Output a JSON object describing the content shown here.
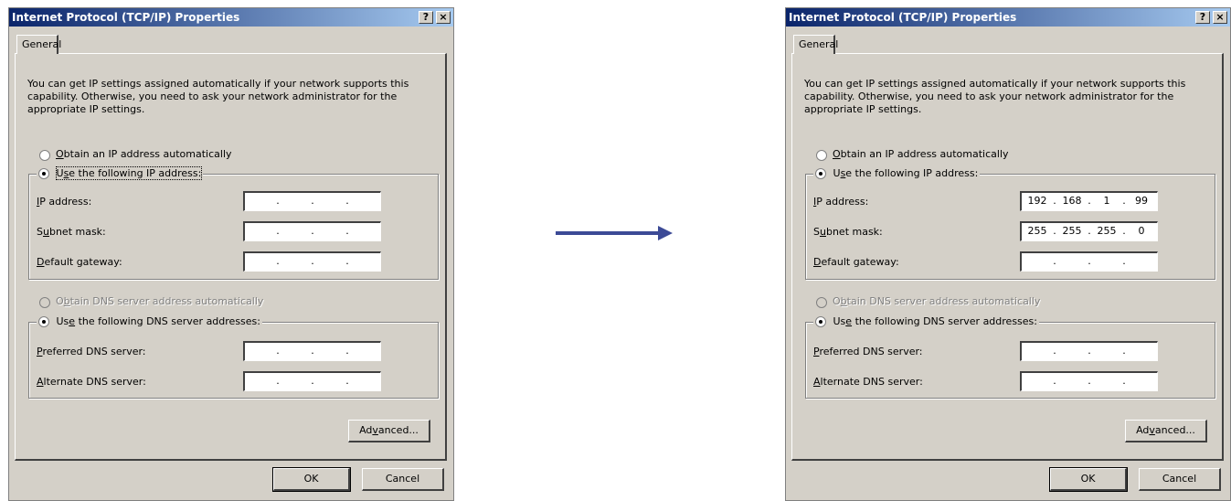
{
  "dialog_title": "Internet Protocol (TCP/IP) Properties",
  "help_button": "?",
  "close_button": "×",
  "tab_general": "General",
  "intro_text": "You can get IP settings assigned automatically if your network supports this capability. Otherwise, you need to ask your network administrator for the appropriate IP settings.",
  "ip_section": {
    "auto_option": {
      "pre": "",
      "key": "O",
      "post": "btain an IP address automatically"
    },
    "manual_option": {
      "pre": "U",
      "key": "s",
      "post": "e the following IP address:"
    },
    "fields": [
      {
        "pre": "",
        "key": "I",
        "post": "P address:"
      },
      {
        "pre": "S",
        "key": "u",
        "post": "bnet mask:"
      },
      {
        "pre": "",
        "key": "D",
        "post": "efault gateway:"
      }
    ]
  },
  "dns_section": {
    "auto_option": {
      "pre": "O",
      "key": "b",
      "post": "tain DNS server address automatically"
    },
    "manual_option": {
      "pre": "Us",
      "key": "e",
      "post": " the following DNS server addresses:"
    },
    "fields": [
      {
        "pre": "",
        "key": "P",
        "post": "referred DNS server:"
      },
      {
        "pre": "",
        "key": "A",
        "post": "lternate DNS server:"
      }
    ]
  },
  "advanced_button": {
    "pre": "Ad",
    "key": "v",
    "post": "anced..."
  },
  "ok_button": "OK",
  "cancel_button": "Cancel",
  "separator": ".",
  "before": {
    "ip": [
      "",
      "",
      "",
      ""
    ],
    "subnet": [
      "",
      "",
      "",
      ""
    ],
    "gateway": [
      "",
      "",
      "",
      ""
    ],
    "dns1": [
      "",
      "",
      "",
      ""
    ],
    "dns2": [
      "",
      "",
      "",
      ""
    ]
  },
  "after": {
    "ip": [
      "192",
      "168",
      "1",
      "99"
    ],
    "subnet": [
      "255",
      "255",
      "255",
      "0"
    ],
    "gateway": [
      "",
      "",
      "",
      ""
    ],
    "dns1": [
      "",
      "",
      "",
      ""
    ],
    "dns2": [
      "",
      "",
      "",
      ""
    ]
  },
  "colors": {
    "dialog_face": "#d4d0c8",
    "titlebar_start": "#0a246a",
    "titlebar_end": "#a6caf0",
    "arrow": "#3c4a96"
  },
  "icons": {
    "arrow": "right-arrow-icon",
    "help": "help-icon",
    "close": "close-icon"
  }
}
